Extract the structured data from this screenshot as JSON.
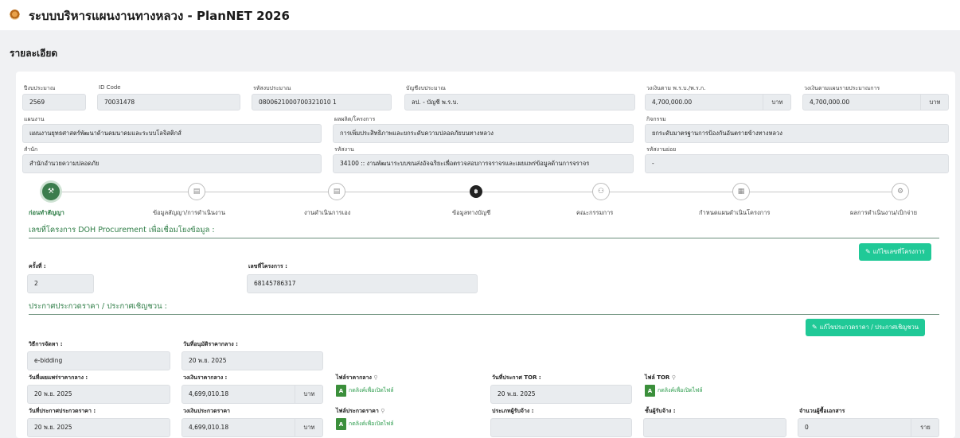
{
  "app": {
    "title": "ระบบบริหารแผนงานทางหลวง - PlanNET 2026"
  },
  "page": {
    "heading": "รายละเอียด"
  },
  "details": {
    "budget_year": {
      "label": "ปีงบประมาณ",
      "value": "2569"
    },
    "id_code": {
      "label": "ID Code",
      "value": "70031478"
    },
    "budget_code": {
      "label": "รหัสงบประมาณ",
      "value": "0800621000700321010 1"
    },
    "budget_account": {
      "label": "บัญชีงบประมาณ",
      "value": "ลป. - บัญชี พ.ร.บ."
    },
    "amount_act": {
      "label": "วงเงินตาม พ.ร.บ./พ.ร.ก.",
      "value": "4,700,000.00",
      "unit": "บาท"
    },
    "amount_plan": {
      "label": "วงเงินตามแผนรายประมาณการ",
      "value": "4,700,000.00",
      "unit": "บาท"
    },
    "plan": {
      "label": "แผนงาน",
      "value": "แผนงานยุทธศาสตร์พัฒนาด้านคมนาคมและระบบโลจิสติกส์"
    },
    "output": {
      "label": "ผลผลิต/โครงการ",
      "value": "การเพิ่มประสิทธิภาพและยกระดับความปลอดภัยบนทางหลวง"
    },
    "activity": {
      "label": "กิจกรรม",
      "value": "ยกระดับมาตรฐานการป้องกันอันตรายข้างทางหลวง"
    },
    "office": {
      "label": "สำนัก",
      "value": "สำนักอำนวยความปลอดภัย"
    },
    "work_code": {
      "label": "รหัสงาน",
      "value": "34100 :: งานพัฒนาระบบขนส่งอัจฉริยะเพื่อตรวจสอบการจราจรและเผยแพร่ข้อมูลด้านการจราจร"
    },
    "sub_work_code": {
      "label": "รหัสงานย่อย",
      "value": "-"
    }
  },
  "steps": [
    {
      "label": "ก่อนทำสัญญา",
      "icon": "gavel-icon",
      "glyph": "⚒"
    },
    {
      "label": "ข้อมูลสัญญา/การดำเนินงาน",
      "icon": "document-icon",
      "glyph": "▤"
    },
    {
      "label": "งานดำเนินการเอง",
      "icon": "clipboard-icon",
      "glyph": "▤"
    },
    {
      "label": "ข้อมูลทางบัญชี",
      "icon": "coin-icon",
      "glyph": "฿"
    },
    {
      "label": "คณะกรรมการ",
      "icon": "users-icon",
      "glyph": "⚇"
    },
    {
      "label": "กำหนดแผนดำเนินโครงการ",
      "icon": "calendar-icon",
      "glyph": "▦"
    },
    {
      "label": "ผลการดำเนินงาน/เบิกจ่าย",
      "icon": "money-icon",
      "glyph": "⚙"
    }
  ],
  "procurement": {
    "title": "เลขที่โครงการ DOH Procurement เพื่อเชื่อมโยงข้อมูล :",
    "edit_button": "แก้ไขเลขที่โครงการ",
    "round": {
      "label": "ครั้งที่ :",
      "value": "2"
    },
    "project_no": {
      "label": "เลขที่โครงการ :",
      "value": "68145786317"
    }
  },
  "announcement": {
    "title": "ประกาศประกวดราคา / ประกาศเชิญชวน :",
    "edit_button": "แก้ไขประกวดราคา / ประกาศเชิญชวน",
    "method": {
      "label": "วิธีการจัดหา :",
      "value": "e-bidding"
    },
    "median_approve_date": {
      "label": "วันที่อนุมัติราคากลาง :",
      "value": "20 พ.ย. 2025"
    },
    "median_publish_date": {
      "label": "วันที่เผยแพร่ราคากลาง :",
      "value": "20 พ.ย. 2025"
    },
    "median_amount": {
      "label": "วงเงินราคากลาง :",
      "value": "4,699,010.18",
      "unit": "บาท"
    },
    "median_file": {
      "label": "ไฟล์ราคากลาง",
      "link": "กดลิงค์เพื่อเปิดไฟล์"
    },
    "tor_date": {
      "label": "วันที่ประกาศ TOR :",
      "value": "20 พ.ย. 2025"
    },
    "tor_file": {
      "label": "ไฟล์ TOR",
      "link": "กดลิงค์เพื่อเปิดไฟล์"
    },
    "bid_date": {
      "label": "วันที่ประกาศประกวดราคา :",
      "value": "20 พ.ย. 2025"
    },
    "bid_amount": {
      "label": "วงเงินประกวดราคา",
      "value": "4,699,010.18",
      "unit": "บาท"
    },
    "bid_file": {
      "label": "ไฟล์ประกวดราคา",
      "link": "กดลิงค์เพื่อเปิดไฟล์"
    },
    "bidder_type": {
      "label": "ประเภทผู้รับจ้าง :",
      "value": ""
    },
    "contractor_class": {
      "label": "ชั้นผู้รับจ้าง :",
      "value": ""
    },
    "doc_buyers": {
      "label": "จำนวนผู้ซื้อเอกสาร",
      "value": "0",
      "unit": "ราย"
    }
  },
  "colors": {
    "accent": "#2e7d46",
    "button": "#20c997",
    "field_bg": "#e9ecef"
  }
}
